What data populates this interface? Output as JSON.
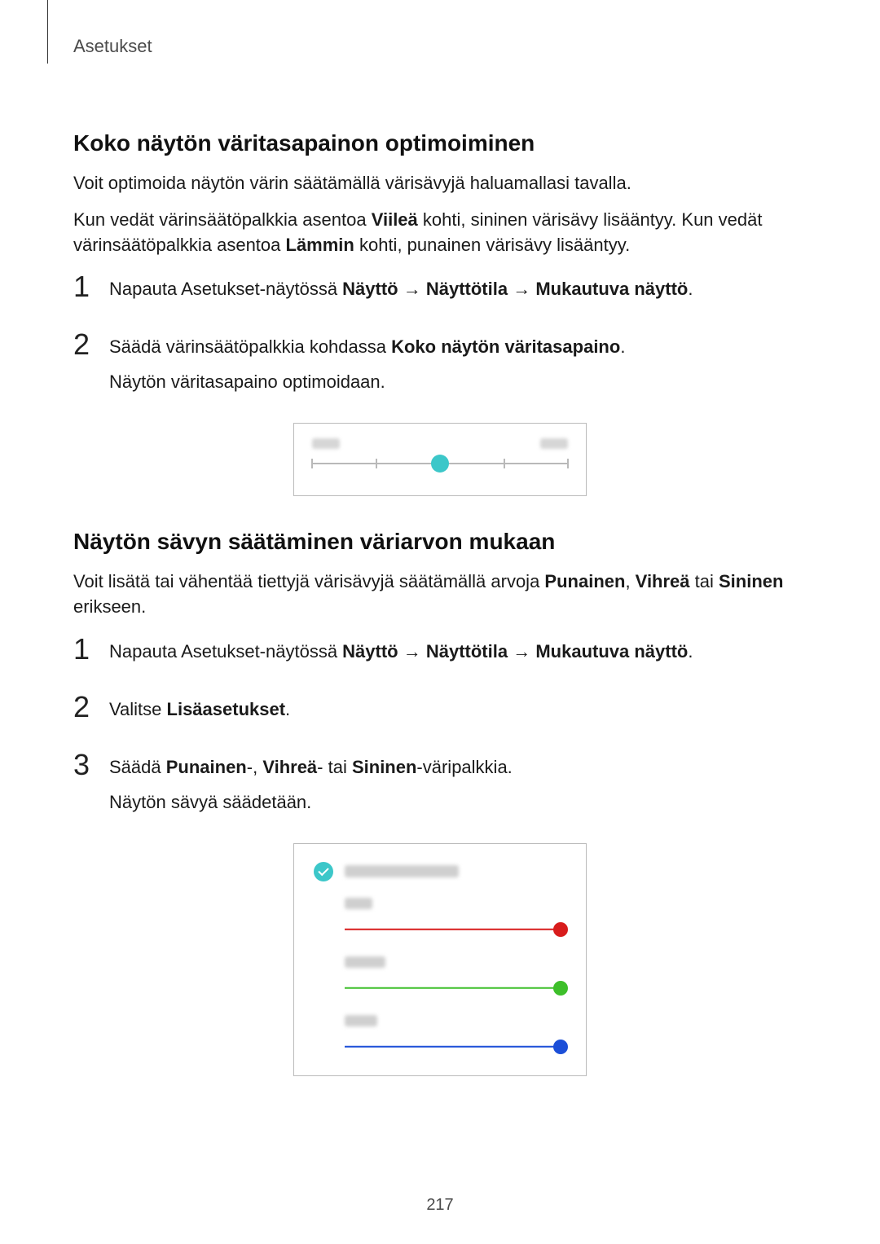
{
  "header": {
    "breadcrumb": "Asetukset"
  },
  "section1": {
    "title": "Koko näytön väritasapainon optimoiminen",
    "p1": "Voit optimoida näytön värin säätämällä värisävyjä haluamallasi tavalla.",
    "p2_a": "Kun vedät värinsäätöpalkkia asentoa ",
    "p2_b1": "Viileä",
    "p2_c": " kohti, sininen värisävy lisääntyy. Kun vedät värinsäätöpalkkia asentoa ",
    "p2_b2": "Lämmin",
    "p2_d": " kohti, punainen värisävy lisääntyy.",
    "steps": [
      {
        "num": "1",
        "pre": "Napauta Asetukset-näytössä ",
        "b1": "Näyttö",
        "arrow1": " → ",
        "b2": "Näyttötila",
        "arrow2": " → ",
        "b3": "Mukautuva näyttö",
        "post": "."
      },
      {
        "num": "2",
        "pre": "Säädä värinsäätöpalkkia kohdassa ",
        "b1": "Koko näytön väritasapaino",
        "post": ".",
        "extra": "Näytön väritasapaino optimoidaan."
      }
    ]
  },
  "section2": {
    "title": "Näytön sävyn säätäminen väriarvon mukaan",
    "p1_a": "Voit lisätä tai vähentää tiettyjä värisävyjä säätämällä arvoja ",
    "p1_b1": "Punainen",
    "p1_c": ", ",
    "p1_b2": "Vihreä",
    "p1_d": " tai ",
    "p1_b3": "Sininen",
    "p1_e": " erikseen.",
    "steps": [
      {
        "num": "1",
        "pre": "Napauta Asetukset-näytössä ",
        "b1": "Näyttö",
        "arrow1": " → ",
        "b2": "Näyttötila",
        "arrow2": " → ",
        "b3": "Mukautuva näyttö",
        "post": "."
      },
      {
        "num": "2",
        "pre": "Valitse ",
        "b1": "Lisäasetukset",
        "post": "."
      },
      {
        "num": "3",
        "pre": "Säädä ",
        "b1": "Punainen",
        "mid1": "-, ",
        "b2": "Vihreä",
        "mid2": "- tai ",
        "b3": "Sininen",
        "post": "-väripalkkia.",
        "extra": "Näytön sävyä säädetään."
      }
    ]
  },
  "pageNumber": "217"
}
